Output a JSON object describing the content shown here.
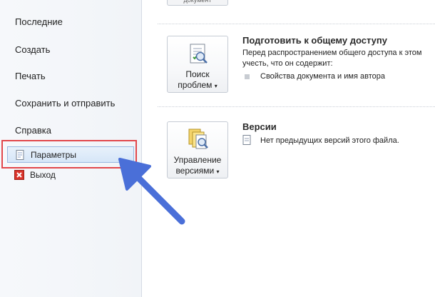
{
  "sidebar": {
    "items": [
      {
        "label": "Последние"
      },
      {
        "label": "Создать"
      },
      {
        "label": "Печать"
      },
      {
        "label": "Сохранить и отправить"
      },
      {
        "label": "Справка"
      }
    ],
    "options_label": "Параметры",
    "exit_label": "Выход"
  },
  "main": {
    "top_stub_label": "документ",
    "share": {
      "title": "Подготовить к общему доступу",
      "desc_line1": "Перед распространением общего доступа к этом",
      "desc_line2": "учесть, что он содержит:",
      "bullet": "Свойства документа и имя автора",
      "button_line1": "Поиск",
      "button_line2": "проблем"
    },
    "versions": {
      "title": "Версии",
      "desc": "Нет предыдущих версий этого файла.",
      "button_line1": "Управление",
      "button_line2": "версиями"
    }
  },
  "colors": {
    "highlight": "#e2474b",
    "arrow": "#4a6fd8",
    "selected_bg": "#dbe8f8"
  }
}
